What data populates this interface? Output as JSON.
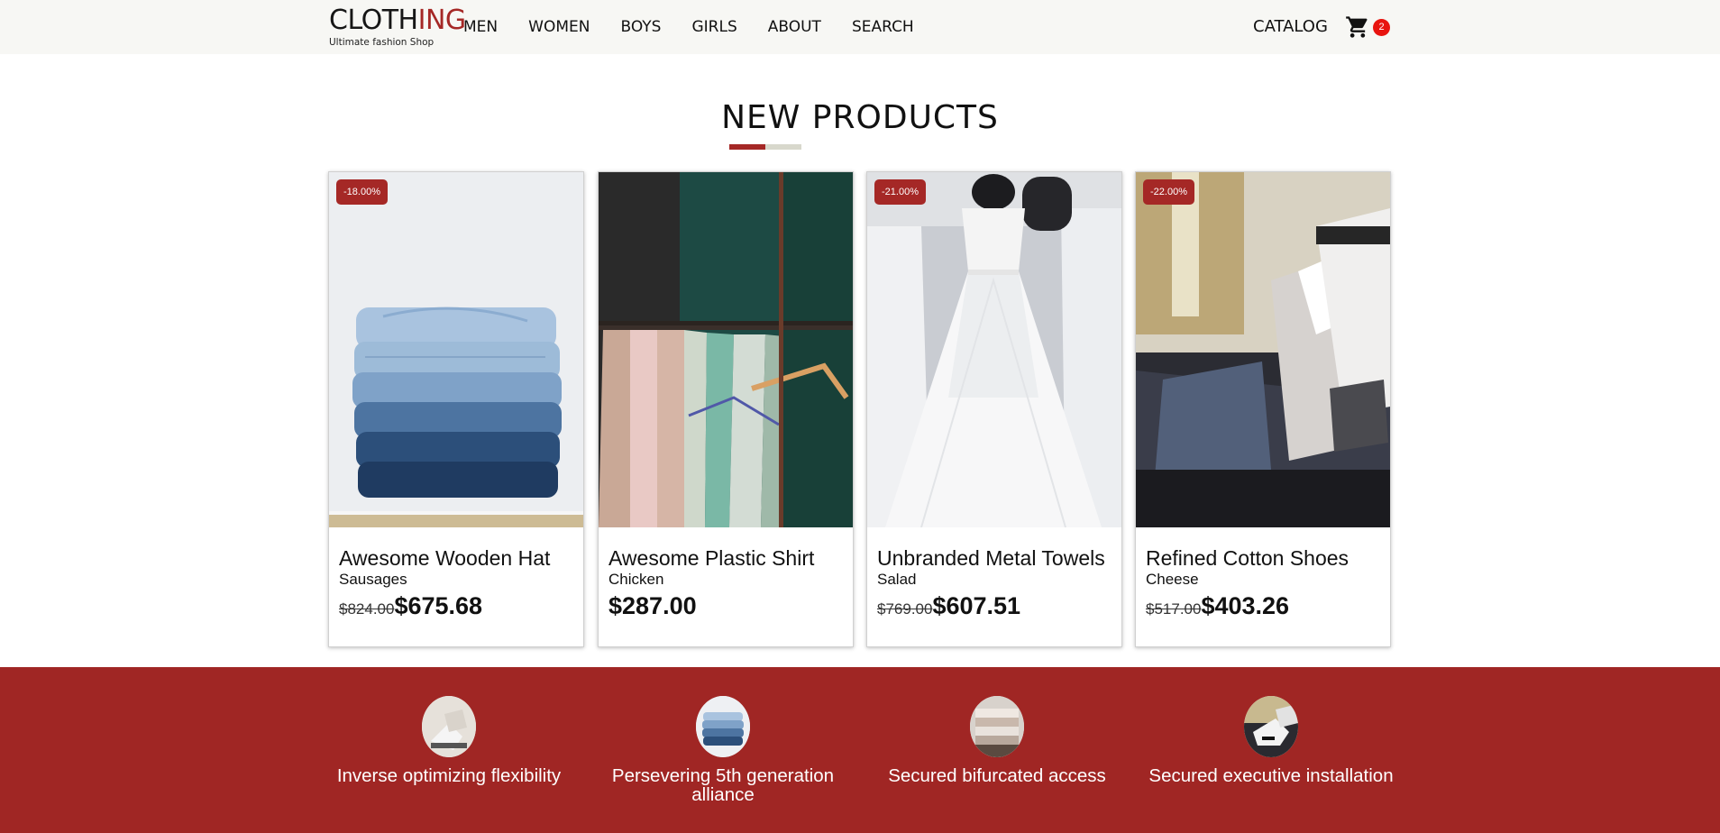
{
  "nav": {
    "logo_part1": "CLOTH",
    "logo_part2": "ING",
    "logo_tagline": "Ultimate fashion Shop",
    "links": [
      "MEN",
      "WOMEN",
      "BOYS",
      "GIRLS",
      "ABOUT",
      "SEARCH"
    ],
    "catalog": "CATALOG",
    "cart_count": "2",
    "cart_icon": "cart-icon"
  },
  "section": {
    "title": "NEW PRODUCTS"
  },
  "colors": {
    "brand_red": "#a52826",
    "badge_red": "#e8140f",
    "nav_bg": "#f7f7f4"
  },
  "products": [
    {
      "name": "Awesome Wooden Hat",
      "category": "Sausages",
      "discount": "-18.00%",
      "old_price": "$824.00",
      "price": "$675.68",
      "image": "folded-jeans-photo"
    },
    {
      "name": "Awesome Plastic Shirt",
      "category": "Chicken",
      "discount": "",
      "old_price": "",
      "price": "$287.00",
      "image": "clothing-rack-photo"
    },
    {
      "name": "Unbranded Metal Towels",
      "category": "Salad",
      "discount": "-21.00%",
      "old_price": "$769.00",
      "price": "$607.51",
      "image": "wedding-dress-photo"
    },
    {
      "name": "Refined Cotton Shoes",
      "category": "Cheese",
      "discount": "-22.00%",
      "old_price": "$517.00",
      "price": "$403.26",
      "image": "shirts-display-photo"
    }
  ],
  "features": [
    {
      "label": "Inverse optimizing flexibility",
      "image": "shoes-thumbnail"
    },
    {
      "label": "Persevering 5th generation alliance",
      "image": "jeans-thumbnail"
    },
    {
      "label": "Secured bifurcated access",
      "image": "towels-thumbnail"
    },
    {
      "label": "Secured executive installation",
      "image": "sneakers-thumbnail"
    }
  ]
}
